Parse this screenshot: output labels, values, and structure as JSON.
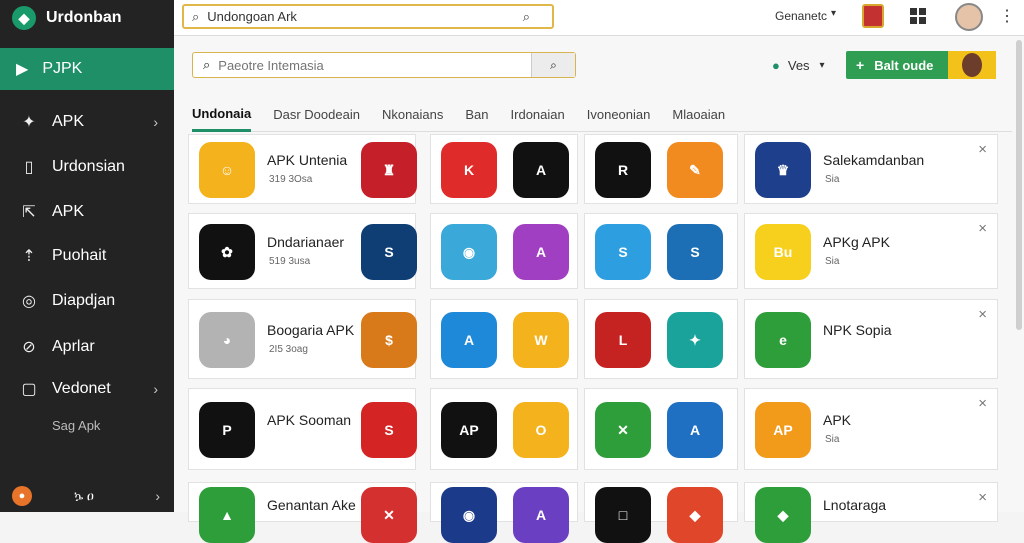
{
  "topbar": {
    "brand": "Urdonban",
    "search_value": "Undongoan Ark",
    "right_text": "Genanetc",
    "caret": "▾"
  },
  "sidebar": {
    "active": "PJPK",
    "items": [
      {
        "label": "APK",
        "icon": "gamepad-icon",
        "glyph": "✦",
        "chevron": "›"
      },
      {
        "label": "Urdonsian",
        "icon": "device-icon",
        "glyph": "▯",
        "chevron": ""
      },
      {
        "label": "APK",
        "icon": "share-icon",
        "glyph": "⇱",
        "chevron": ""
      },
      {
        "label": "Puohait",
        "icon": "upload-icon",
        "glyph": "⇡",
        "chevron": ""
      },
      {
        "label": "Diapdjan",
        "icon": "target-icon",
        "glyph": "◎",
        "chevron": ""
      },
      {
        "label": "Aprlar",
        "icon": "compass-icon",
        "glyph": "⊘",
        "chevron": ""
      },
      {
        "label": "Vedonet",
        "icon": "folder-icon",
        "glyph": "▢",
        "chevron": "›"
      }
    ],
    "sub": "Sag Apk",
    "bottom_label": "ኴ ዐ"
  },
  "main": {
    "search_placeholder": "Paeotre Intemasia",
    "user_label": "Ves",
    "cta_label": "Balt oude",
    "tabs": [
      "Undonaia",
      "Dasr Doodeain",
      "Nkonaians",
      "Ban",
      "Irdonaian",
      "Ivoneonian",
      "Mlaoaian"
    ]
  },
  "cards": [
    {
      "title": "APK Untenia",
      "meta": "319 3Osa",
      "icons": [
        "#f4b21c",
        "#c51f2a"
      ],
      "glyphs": [
        "☺",
        "♜"
      ],
      "close": false
    },
    {
      "title": "",
      "meta": "",
      "icons": [
        "#e02b2b",
        "#111111"
      ],
      "glyphs": [
        "K",
        "A"
      ],
      "close": false
    },
    {
      "title": "",
      "meta": "",
      "icons": [
        "#111111",
        "#f18a1f"
      ],
      "glyphs": [
        "R",
        "✎"
      ],
      "close": false
    },
    {
      "title": "Salekamdanban",
      "meta": "Sia",
      "icons": [
        "#1d3f8c"
      ],
      "glyphs": [
        "♛"
      ],
      "close": true
    },
    {
      "title": "Dndarianaer",
      "meta": "519 3usa",
      "icons": [
        "#111111",
        "#0e3e73"
      ],
      "glyphs": [
        "✿",
        "S"
      ],
      "close": false
    },
    {
      "title": "",
      "meta": "",
      "icons": [
        "#3aa8d9",
        "#a13fc2"
      ],
      "glyphs": [
        "◉",
        "A"
      ],
      "close": false
    },
    {
      "title": "",
      "meta": "",
      "icons": [
        "#2d9fe0",
        "#1d6fb5"
      ],
      "glyphs": [
        "S",
        "S"
      ],
      "close": false
    },
    {
      "title": "APKg APK",
      "meta": "Sia",
      "icons": [
        "#f6d01c"
      ],
      "glyphs": [
        "Bu"
      ],
      "close": true
    },
    {
      "title": "Boogaria APK",
      "meta": "2I5 3oag",
      "icons": [
        "#b3b3b3",
        "#d97a1a"
      ],
      "glyphs": [
        "◕",
        "$"
      ],
      "close": false
    },
    {
      "title": "",
      "meta": "",
      "icons": [
        "#1e88d9",
        "#f4b21c"
      ],
      "glyphs": [
        "A",
        "W"
      ],
      "close": false
    },
    {
      "title": "",
      "meta": "",
      "icons": [
        "#c52222",
        "#1aa39a"
      ],
      "glyphs": [
        "L",
        "✦"
      ],
      "close": false
    },
    {
      "title": "NPK Sopia",
      "meta": "",
      "icons": [
        "#2e9e3a"
      ],
      "glyphs": [
        "e"
      ],
      "close": true
    },
    {
      "title": "APK Sooman",
      "meta": "",
      "icons": [
        "#111111",
        "#d42424"
      ],
      "glyphs": [
        "P",
        "S"
      ],
      "close": false
    },
    {
      "title": "",
      "meta": "",
      "icons": [
        "#111111",
        "#f4b21c"
      ],
      "glyphs": [
        "AP",
        "O"
      ],
      "close": false
    },
    {
      "title": "",
      "meta": "",
      "icons": [
        "#2e9e3a",
        "#1f6fc2"
      ],
      "glyphs": [
        "✕",
        "A"
      ],
      "close": false
    },
    {
      "title": "APK",
      "meta": "Sia",
      "icons": [
        "#f29a1a"
      ],
      "glyphs": [
        "AP"
      ],
      "close": true
    },
    {
      "title": "Genantan Ake",
      "meta": "",
      "icons": [
        "#2e9e3a",
        "#d43030"
      ],
      "glyphs": [
        "▲",
        "✕"
      ],
      "close": false
    },
    {
      "title": "",
      "meta": "",
      "icons": [
        "#1c3a8a",
        "#6a3fc2"
      ],
      "glyphs": [
        "◉",
        "A"
      ],
      "close": false
    },
    {
      "title": "",
      "meta": "",
      "icons": [
        "#111111",
        "#e0462a"
      ],
      "glyphs": [
        "□",
        "◆"
      ],
      "close": false
    },
    {
      "title": "Lnotaraga",
      "meta": "",
      "icons": [
        "#2e9e3a"
      ],
      "glyphs": [
        "◆"
      ],
      "close": true
    }
  ]
}
